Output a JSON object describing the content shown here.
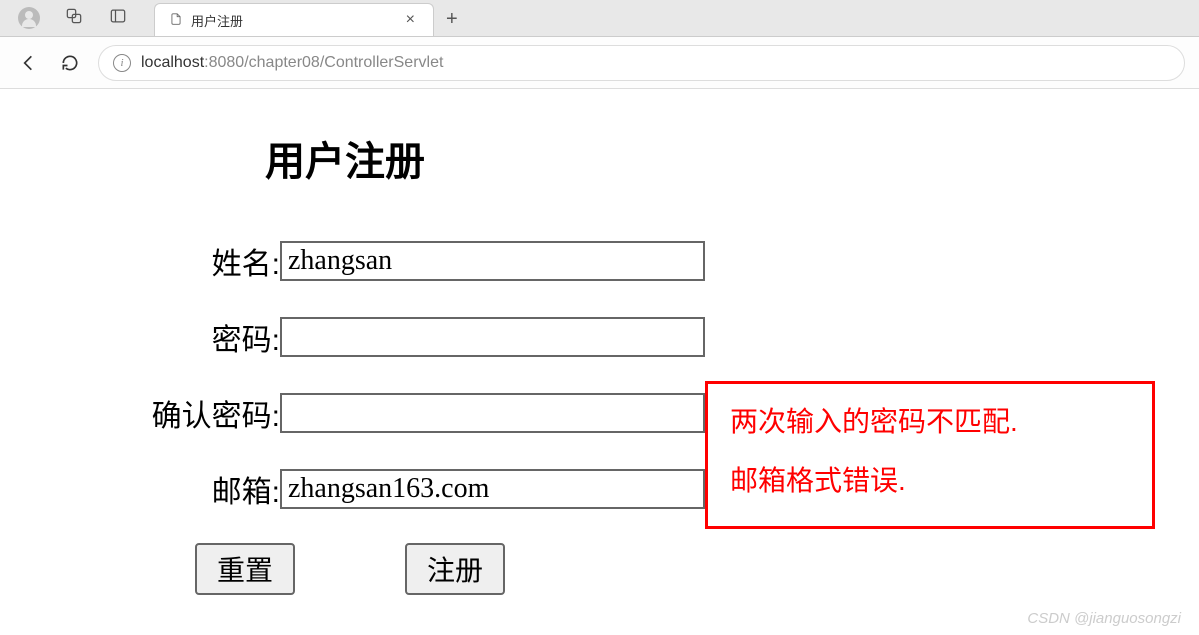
{
  "browser": {
    "tab_title": "用户注册",
    "url_host": "localhost",
    "url_port": ":8080",
    "url_path": "/chapter08/ControllerServlet",
    "info_glyph": "i",
    "close_glyph": "×",
    "plus_glyph": "+"
  },
  "page": {
    "title": "用户注册",
    "labels": {
      "name": "姓名:",
      "password": "密码:",
      "confirm": "确认密码:",
      "email": "邮箱:"
    },
    "values": {
      "name": "zhangsan",
      "password": "",
      "confirm": "",
      "email": "zhangsan163.com"
    },
    "buttons": {
      "reset": "重置",
      "submit": "注册"
    }
  },
  "errors": [
    "两次输入的密码不匹配.",
    "邮箱格式错误."
  ],
  "watermark": "CSDN @jianguosongzi"
}
